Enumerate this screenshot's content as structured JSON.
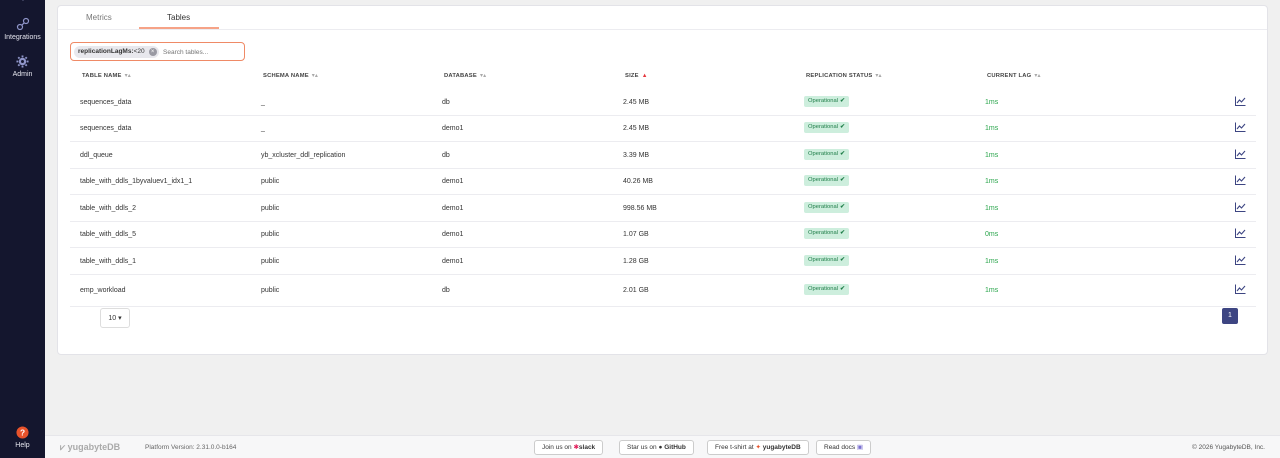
{
  "sidebar": {
    "integrations_label": "Integrations",
    "admin_label": "Admin",
    "help_label": "Help"
  },
  "tabs": [
    {
      "label": "Metrics",
      "active": false
    },
    {
      "label": "Tables",
      "active": true
    }
  ],
  "search": {
    "chip_key": "replicationLagMs:",
    "chip_value": "<20",
    "placeholder": "Search tables..."
  },
  "columns": {
    "table_name": "TABLE NAME",
    "schema_name": "SCHEMA NAME",
    "database": "DATABASE",
    "size": "SIZE",
    "replication_status": "REPLICATION STATUS",
    "current_lag": "CURRENT LAG"
  },
  "rows": [
    {
      "table_name": "sequences_data",
      "schema_name": "_",
      "database": "db",
      "size": "2.45 MB",
      "status": "Operational",
      "lag": "1ms"
    },
    {
      "table_name": "sequences_data",
      "schema_name": "_",
      "database": "demo1",
      "size": "2.45 MB",
      "status": "Operational",
      "lag": "1ms"
    },
    {
      "table_name": "ddl_queue",
      "schema_name": "yb_xcluster_ddl_replication",
      "database": "db",
      "size": "3.39 MB",
      "status": "Operational",
      "lag": "1ms"
    },
    {
      "table_name": "table_with_ddls_1byvaluev1_idx1_1",
      "schema_name": "public",
      "database": "demo1",
      "size": "40.26 MB",
      "status": "Operational",
      "lag": "1ms"
    },
    {
      "table_name": "table_with_ddls_2",
      "schema_name": "public",
      "database": "demo1",
      "size": "998.56 MB",
      "status": "Operational",
      "lag": "1ms"
    },
    {
      "table_name": "table_with_ddls_5",
      "schema_name": "public",
      "database": "demo1",
      "size": "1.07 GB",
      "status": "Operational",
      "lag": "0ms"
    },
    {
      "table_name": "table_with_ddls_1",
      "schema_name": "public",
      "database": "demo1",
      "size": "1.28 GB",
      "status": "Operational",
      "lag": "1ms"
    },
    {
      "table_name": "emp_workload",
      "schema_name": "public",
      "database": "db",
      "size": "2.01 GB",
      "status": "Operational",
      "lag": "1ms"
    }
  ],
  "pagination": {
    "page_size": "10",
    "current_page": "1"
  },
  "footer": {
    "logo": "yugabyteDB",
    "version": "Platform Version: 2.31.0.0-b164",
    "slack_prefix": "Join us on",
    "slack_brand": "slack",
    "github_prefix": "Star us on",
    "github_brand": "GitHub",
    "tshirt_prefix": "Free t-shirt at",
    "tshirt_brand": "yugabyteDB",
    "docs_label": "Read docs",
    "copyright": "© 2026 YugabyteDB, Inc."
  },
  "colors": {
    "sidebar_bg": "#14162e",
    "accent": "#ef5824",
    "status_green": "#2aa54c",
    "badge_bg": "#cdeedd",
    "pagination_active": "#3d4582"
  }
}
